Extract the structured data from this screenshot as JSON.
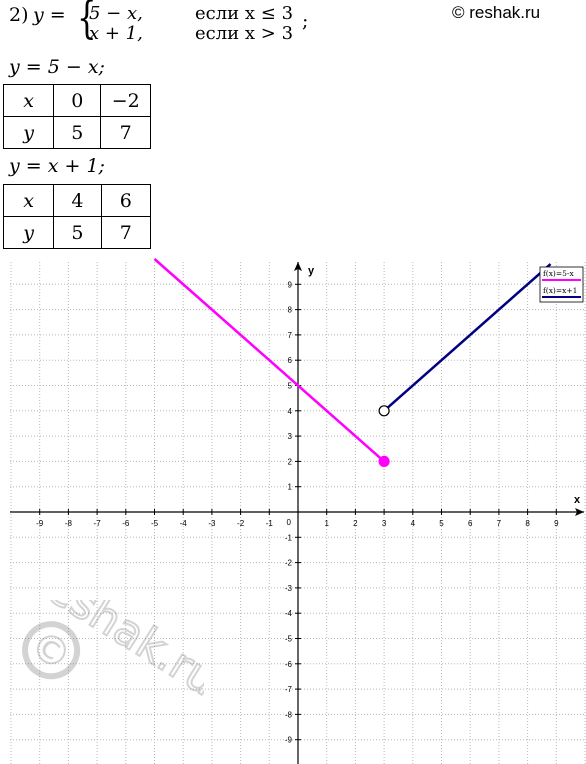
{
  "header": {
    "problem_number": "2)",
    "lhs": "y =",
    "case1_expr": "5 − x,",
    "case1_cond": "если x ≤ 3",
    "case2_expr": "x + 1,",
    "case2_cond": "если x > 3",
    "terminator": ";",
    "site": "© reshak.ru"
  },
  "table1": {
    "equation": "y = 5 − x;",
    "row_x": [
      "x",
      "0",
      "−2"
    ],
    "row_y": [
      "y",
      "5",
      "7"
    ]
  },
  "table2": {
    "equation": "y = x + 1;",
    "row_x": [
      "x",
      "4",
      "6"
    ],
    "row_y": [
      "y",
      "5",
      "7"
    ]
  },
  "watermark": {
    "text": "reshak.ru",
    "symbol": "©"
  },
  "chart_data": {
    "type": "line",
    "xlabel": "x",
    "ylabel": "y",
    "xlim": [
      -10,
      10
    ],
    "ylim": [
      -10,
      10
    ],
    "x_ticks": [
      -9,
      -8,
      -7,
      -6,
      -5,
      -4,
      -3,
      -2,
      -1,
      1,
      2,
      3,
      4,
      5,
      6,
      7,
      8,
      9
    ],
    "y_ticks": [
      -9,
      -8,
      -7,
      -6,
      -5,
      -4,
      -3,
      -2,
      -1,
      1,
      2,
      3,
      4,
      5,
      6,
      7,
      8,
      9
    ],
    "origin_label": "0",
    "grid": true,
    "legend_position": "top-right",
    "series": [
      {
        "name": "f(x)=5-x",
        "color": "#ff00ff",
        "x": [
          -5,
          3
        ],
        "y": [
          10,
          2
        ]
      },
      {
        "name": "f(x)=x+1",
        "color": "#000080",
        "x": [
          3,
          8.8
        ],
        "y": [
          4,
          9.8
        ]
      }
    ],
    "points": [
      {
        "x": 3,
        "y": 2,
        "filled": true,
        "color": "#ff00ff"
      },
      {
        "x": 3,
        "y": 4,
        "filled": false,
        "color": "#000080"
      }
    ]
  }
}
